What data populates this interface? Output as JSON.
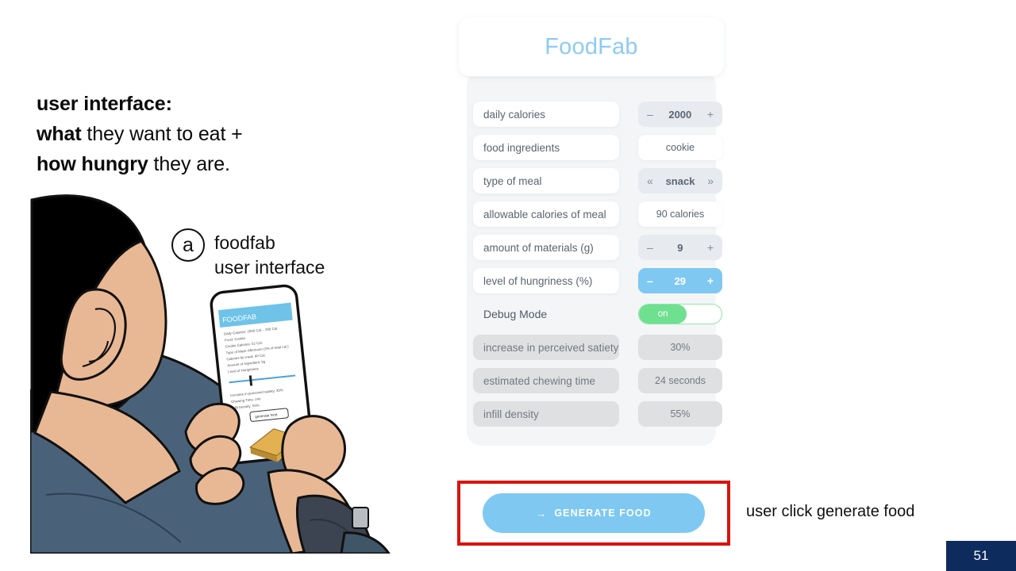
{
  "headline": {
    "line1_bold": "user interface:",
    "line2_bold": "what",
    "line2_rest": " they want to eat +",
    "line3_bold": "how hungry",
    "line3_rest": " they are."
  },
  "figure_caption": {
    "marker": "a",
    "line1": "foodfab",
    "line2": "user interface"
  },
  "app": {
    "title": "FoodFab",
    "rows": [
      {
        "label": "daily calories",
        "type": "stepper",
        "value": "2000",
        "minus": "–",
        "plus": "+",
        "style": "grey"
      },
      {
        "label": "food ingredients",
        "type": "value",
        "value": "cookie",
        "style": "white"
      },
      {
        "label": "type of meal",
        "type": "selector",
        "value": "snack",
        "prev": "«",
        "next": "»",
        "style": "grey"
      },
      {
        "label": "allowable calories of meal",
        "type": "value",
        "value": "90 calories",
        "style": "white"
      },
      {
        "label": "amount of materials (g)",
        "type": "stepper",
        "value": "9",
        "minus": "–",
        "plus": "+",
        "style": "grey"
      },
      {
        "label": "level of hungriness (%)",
        "type": "stepper",
        "value": "29",
        "minus": "–",
        "plus": "+",
        "style": "blue"
      },
      {
        "label": "Debug Mode",
        "type": "toggle",
        "value": "on",
        "style": "plain"
      },
      {
        "label": "increase in perceived satiety",
        "type": "value",
        "value": "30%",
        "style": "dim"
      },
      {
        "label": "estimated chewing time",
        "type": "value",
        "value": "24 seconds",
        "style": "dim"
      },
      {
        "label": "infill density",
        "type": "value",
        "value": "55%",
        "style": "dim"
      }
    ],
    "generate_button": {
      "arrow": "→",
      "label": "GENERATE FOOD"
    }
  },
  "annotation": {
    "click_note": "user click generate food",
    "highlight_color": "#d8140e"
  },
  "phone_mock": {
    "app_bar_title": "FOODFAB",
    "button_label": "generate food"
  },
  "page_number": "51",
  "colors": {
    "accent_blue": "#7fc8f2",
    "title_blue": "#8ecbf2",
    "toggle_green": "#6fdf90",
    "panel_grey": "#f4f5f7",
    "page_navy": "#0e2b5e",
    "shirt_blue": "#4a6279",
    "skin": "#e8b894",
    "hair": "#000000"
  }
}
